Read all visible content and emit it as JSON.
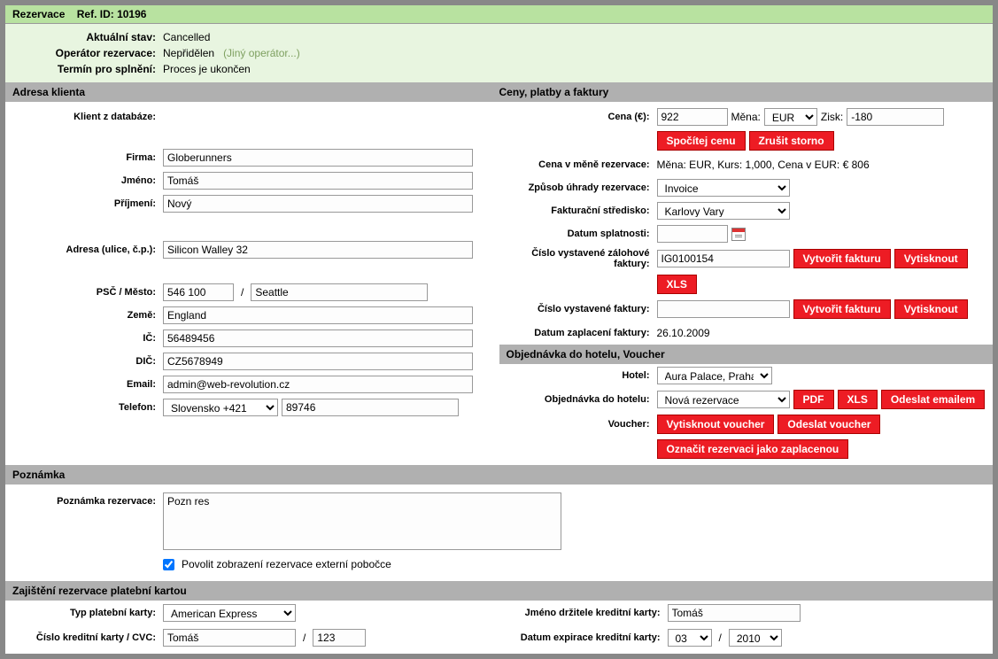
{
  "header": {
    "title_prefix": "Rezervace",
    "ref_label": "Ref. ID:",
    "ref_id": "10196",
    "status_label": "Aktuální stav:",
    "status": "Cancelled",
    "operator_label": "Operátor rezervace:",
    "operator": "Nepřidělen",
    "operator_link": "(Jiný operátor...)",
    "deadline_label": "Termín pro splnění:",
    "deadline": "Proces je ukončen"
  },
  "section_client": "Adresa klienta",
  "section_prices": "Ceny, platby a faktury",
  "client": {
    "db_label": "Klient z databáze:",
    "company_label": "Firma:",
    "company": "Globerunners",
    "firstname_label": "Jméno:",
    "firstname": "Tomáš",
    "lastname_label": "Příjmení:",
    "lastname": "Nový",
    "address_label": "Adresa (ulice, č.p.):",
    "address": "Silicon Walley 32",
    "zipcity_label": "PSČ / Město:",
    "zip": "546 100",
    "city": "Seattle",
    "country_label": "Země:",
    "country": "England",
    "ic_label": "IČ:",
    "ic": "56489456",
    "dic_label": "DIČ:",
    "dic": "CZ5678949",
    "email_label": "Email:",
    "email": "admin@web-revolution.cz",
    "phone_label": "Telefon:",
    "phone_prefix": "Slovensko +421",
    "phone": "89746"
  },
  "prices": {
    "price_label": "Cena (€):",
    "price": "922",
    "currency_label": "Měna:",
    "currency": "EUR",
    "profit_label": "Zisk:",
    "profit": "-180",
    "btn_calc": "Spočítej cenu",
    "btn_cancel_storno": "Zrušit storno",
    "res_currency_label": "Cena v měně rezervace:",
    "res_currency_text": "Měna: EUR, Kurs: 1,000, Cena v EUR: € 806",
    "payment_label": "Způsob úhrady rezervace:",
    "payment": "Invoice",
    "center_label": "Fakturační středisko:",
    "center": "Karlovy Vary",
    "due_label": "Datum splatnosti:",
    "due": "",
    "advance_label": "Číslo vystavené zálohové faktury:",
    "advance": "IG0100154",
    "btn_create_invoice": "Vytvořit fakturu",
    "btn_print": "Vytisknout",
    "btn_xls": "XLS",
    "invoice_label": "Číslo vystavené faktury:",
    "invoice": "",
    "paid_label": "Datum zaplacení faktury:",
    "paid": "26.10.2009"
  },
  "section_order": "Objednávka do hotelu, Voucher",
  "order": {
    "hotel_label": "Hotel:",
    "hotel": "Aura Palace, Praha",
    "order_label": "Objednávka do hotelu:",
    "order": "Nová rezervace",
    "btn_pdf": "PDF",
    "btn_xls": "XLS",
    "btn_send_email": "Odeslat emailem",
    "voucher_label": "Voucher:",
    "btn_print_voucher": "Vytisknout voucher",
    "btn_send_voucher": "Odeslat voucher",
    "btn_mark_paid": "Označit rezervaci jako zaplacenou"
  },
  "section_note": "Poznámka",
  "note": {
    "label": "Poznámka rezervace:",
    "text": "Pozn res",
    "allow_label": "Povolit zobrazení rezervace externí pobočce"
  },
  "section_cc": "Zajištění rezervace platební kartou",
  "cc": {
    "type_label": "Typ platební karty:",
    "type": "American Express",
    "holder_label": "Jméno držitele kreditní karty:",
    "holder": "Tomáš",
    "number_label": "Číslo kreditní karty / CVC:",
    "number": "Tomáš",
    "cvc": "123",
    "exp_label": "Datum expirace kreditní karty:",
    "exp_month": "03",
    "exp_year": "2010"
  }
}
